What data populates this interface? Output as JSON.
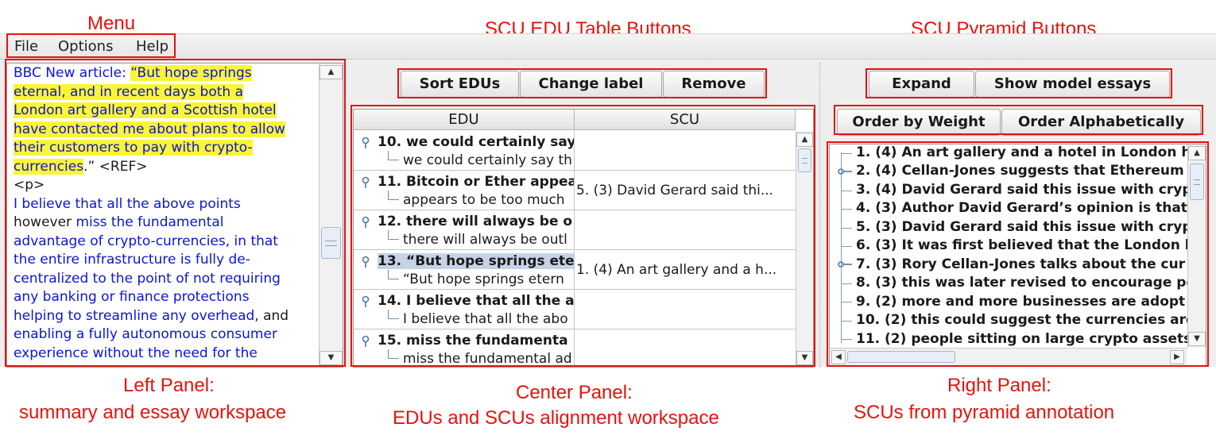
{
  "annotations": {
    "menu": "Menu",
    "scu_edu_buttons": "SCU EDU Table Buttons",
    "scu_pyramid_buttons": "SCU Pyramid Buttons",
    "left_panel_line1": "Left Panel:",
    "left_panel_line2": "summary and essay workspace",
    "center_panel_line1": "Center Panel:",
    "center_panel_line2": "EDUs and SCUs alignment workspace",
    "right_panel_line1": "Right Panel:",
    "right_panel_line2": "SCUs from pyramid annotation"
  },
  "menu": {
    "file": "File",
    "options": "Options",
    "help": "Help"
  },
  "left_panel": {
    "l1a": "BBC New article: ",
    "l1b": "“But hope springs",
    "l2": "eternal, and in recent days both a",
    "l3": "London art gallery and a Scottish hotel",
    "l4": "have contacted me about plans to allow",
    "l5": "their customers to pay with crypto-",
    "l6a": "currencies",
    "l6b": ".” <REF>",
    "l7": "<p>",
    "l8": "I believe that all the above points",
    "l9a": "however ",
    "l9b": "miss the fundamental",
    "l10": "advantage of crypto-currencies, in that",
    "l11": "the entire infrastructure is fully de-",
    "l12": "centralized to the point of not requiring",
    "l13": "any banking or finance protections",
    "l14a": "helping to streamline any overhead,",
    "l14b": " and",
    "l15": "enabling a fully autonomous consumer",
    "l16": "experience without the need for the"
  },
  "center_panel": {
    "buttons": {
      "sort": "Sort EDUs",
      "change": "Change label",
      "remove": "Remove"
    },
    "columns": {
      "edu": "EDU",
      "scu": "SCU"
    },
    "rows": [
      {
        "main": "10. we could certainly say t",
        "sub": "we could certainly say th",
        "scu": ""
      },
      {
        "main": "11. Bitcoin or Ether appea",
        "sub": "appears to be too much",
        "scu": "5. (3) David Gerard said thi..."
      },
      {
        "main": "12. there will always be o",
        "sub": "there will always be outl",
        "scu": ""
      },
      {
        "main": "13. “But hope springs ete",
        "sub": "“But hope springs etern",
        "scu": "1. (4) An art gallery and a h..."
      },
      {
        "main": "14. I believe that all the a",
        "sub": "I believe that all the abo",
        "scu": ""
      },
      {
        "main": "15. miss the fundamenta",
        "sub": "miss the fundamental ad",
        "scu": ""
      }
    ]
  },
  "right_panel": {
    "buttons": {
      "expand": "Expand",
      "show_model": "Show model essays",
      "order_weight": "Order by Weight",
      "order_alpha": "Order Alphabetically"
    },
    "items": [
      "1. (4) An art gallery and a hotel in London h",
      "2. (4) Cellan-Jones suggests that Ethereum",
      "3. (4) David Gerard said this issue with cryp",
      "4. (3) Author David Gerard’s opinion is that",
      "5. (3) David Gerard said this issue with cryp",
      "6. (3) It was first believed that the London l",
      "7. (3) Rory Cellan-Jones talks about the cur",
      "8. (3) this was later revised to encourage pe",
      "9. (2) more and more businesses are adopt",
      "10. (2) this could suggest the currencies are",
      "11. (2) people sitting on large crypto assets"
    ]
  }
}
